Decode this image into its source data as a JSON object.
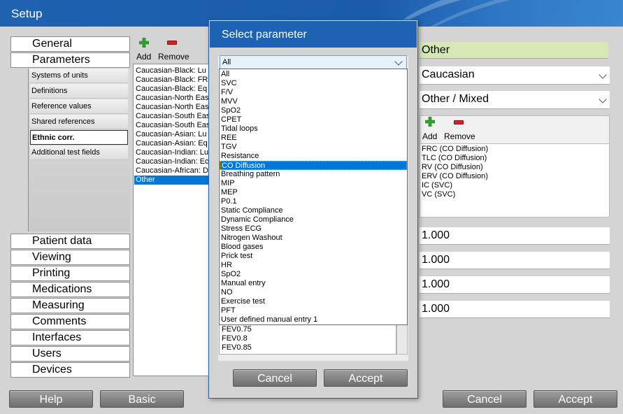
{
  "window": {
    "title": "Setup"
  },
  "nav": {
    "top_tabs": [
      "General",
      "Parameters"
    ],
    "sub_items": [
      "Systems of units",
      "Definitions",
      "Reference values",
      "Shared references",
      "Ethnic corr.",
      "Additional test fields"
    ],
    "bottom_tabs": [
      "Patient data",
      "Viewing",
      "Printing",
      "Medications",
      "Measuring",
      "Comments",
      "Interfaces",
      "Users",
      "Devices"
    ]
  },
  "list_toolbar": {
    "add_label": "Add",
    "remove_label": "Remove"
  },
  "ethnic_list": [
    "Caucasian-Black: Lu",
    "Caucasian-Black: FR",
    "Caucasian-Black: Eq",
    "Caucasian-North Eas",
    "Caucasian-North Eas",
    "Caucasian-South Eas",
    "Caucasian-South Eas",
    "Caucasian-Asian: Lu",
    "Caucasian-Asian: Eq",
    "Caucasian-Indian: Lu",
    "Caucasian-Indian: Ec",
    "Caucasian-African: D",
    "Other"
  ],
  "right_panel": {
    "name_value": "Other",
    "reference_group": "Caucasian",
    "target_group": "Other / Mixed",
    "add_label": "Add",
    "remove_label": "Remove",
    "tests": [
      "FRC (CO Diffusion)",
      "TLC (CO Diffusion)",
      "RV (CO Diffusion)",
      "ERV (CO Diffusion)",
      "IC (SVC)",
      "VC (SVC)"
    ],
    "factors": [
      "1.000",
      "1.000",
      "1.000",
      "1.000"
    ]
  },
  "footer": {
    "help": "Help",
    "basic": "Basic",
    "cancel": "Cancel",
    "accept": "Accept"
  },
  "dialog": {
    "title": "Select parameter",
    "filter_value": "All",
    "options": [
      "All",
      "SVC",
      "F/V",
      "MVV",
      "SpO2",
      "CPET",
      "Tidal loops",
      "REE",
      "TGV",
      "Resistance",
      "CO Diffusion",
      "Breathing pattern",
      "MIP",
      "MEP",
      "P0.1",
      "Static Compliance",
      "Dynamic Compliance",
      "Stress ECG",
      "Nitrogen Washout",
      "Blood gases",
      "Prick test",
      "HR",
      "SpO2",
      "Manual entry",
      "NO",
      "Exercise test",
      "PFT",
      "User defined manual entry 1"
    ],
    "selected_option": "CO Diffusion",
    "parameters_visible": [
      "FEV0.75",
      "FEV0.8",
      "FEV0.85"
    ],
    "cancel": "Cancel",
    "accept": "Accept"
  },
  "colors": {
    "title_blue": "#1e63b3",
    "selection": "#0078d7",
    "name_field": "#d5e8b5"
  }
}
